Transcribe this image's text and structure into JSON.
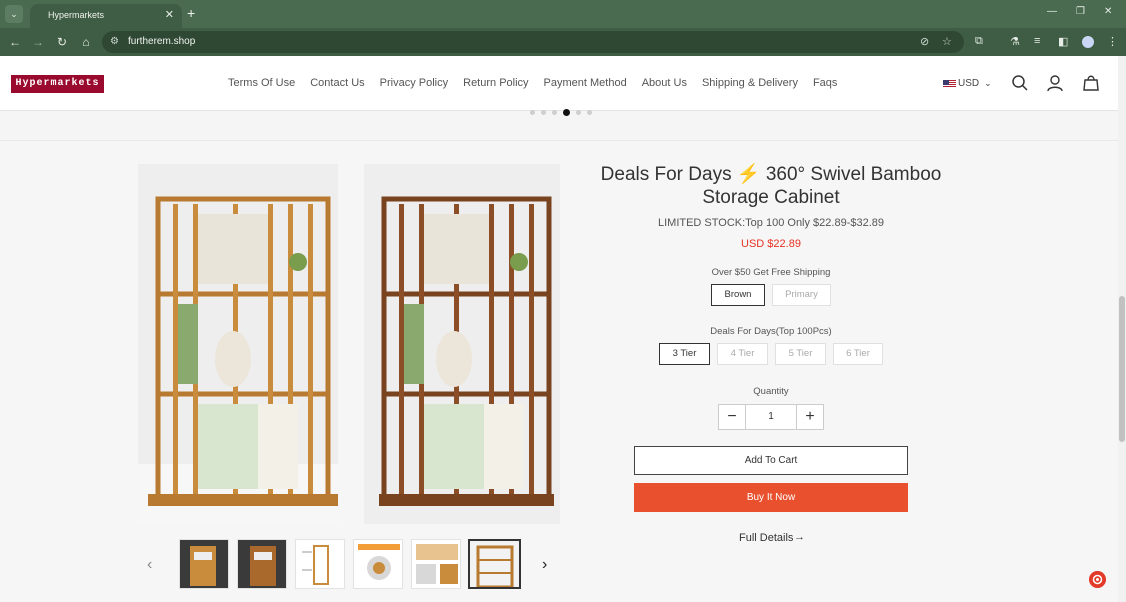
{
  "browser": {
    "tab_title": "Hypermarkets",
    "url": "furtherem.shop"
  },
  "site": {
    "logo": "Hypermarkets",
    "nav": [
      "Terms Of Use",
      "Contact Us",
      "Privacy Policy",
      "Return Policy",
      "Payment Method",
      "About Us",
      "Shipping & Delivery",
      "Faqs"
    ],
    "currency": "USD"
  },
  "carousel": {
    "dot_count": 6,
    "active_dot": 3
  },
  "product": {
    "title_part1": "Deals For Days",
    "title_part2": "360° Swivel Bamboo Storage Cabinet",
    "stock_text": "LIMITED STOCK:Top 100 Only $22.89-$32.89",
    "price": "USD $22.89",
    "color_label": "Over $50 Get Free Shipping",
    "colors": [
      "Brown",
      "Primary"
    ],
    "selected_color": "Brown",
    "tier_label": "Deals For Days(Top 100Pcs)",
    "tiers": [
      "3 Tier",
      "4 Tier",
      "5 Tier",
      "6 Tier"
    ],
    "selected_tier": "3 Tier",
    "quantity_label": "Quantity",
    "quantity": "1",
    "add_to_cart": "Add To Cart",
    "buy_now": "Buy It Now",
    "full_details": "Full Details"
  },
  "colors": {
    "chrome_dark": "#3f5c44",
    "chrome_tab": "#4a6b4f",
    "logo_bg": "#9a0a2e",
    "buy_now_bg": "#e9502e",
    "price_red": "#e63223",
    "bamboo": "#c98b3c"
  }
}
